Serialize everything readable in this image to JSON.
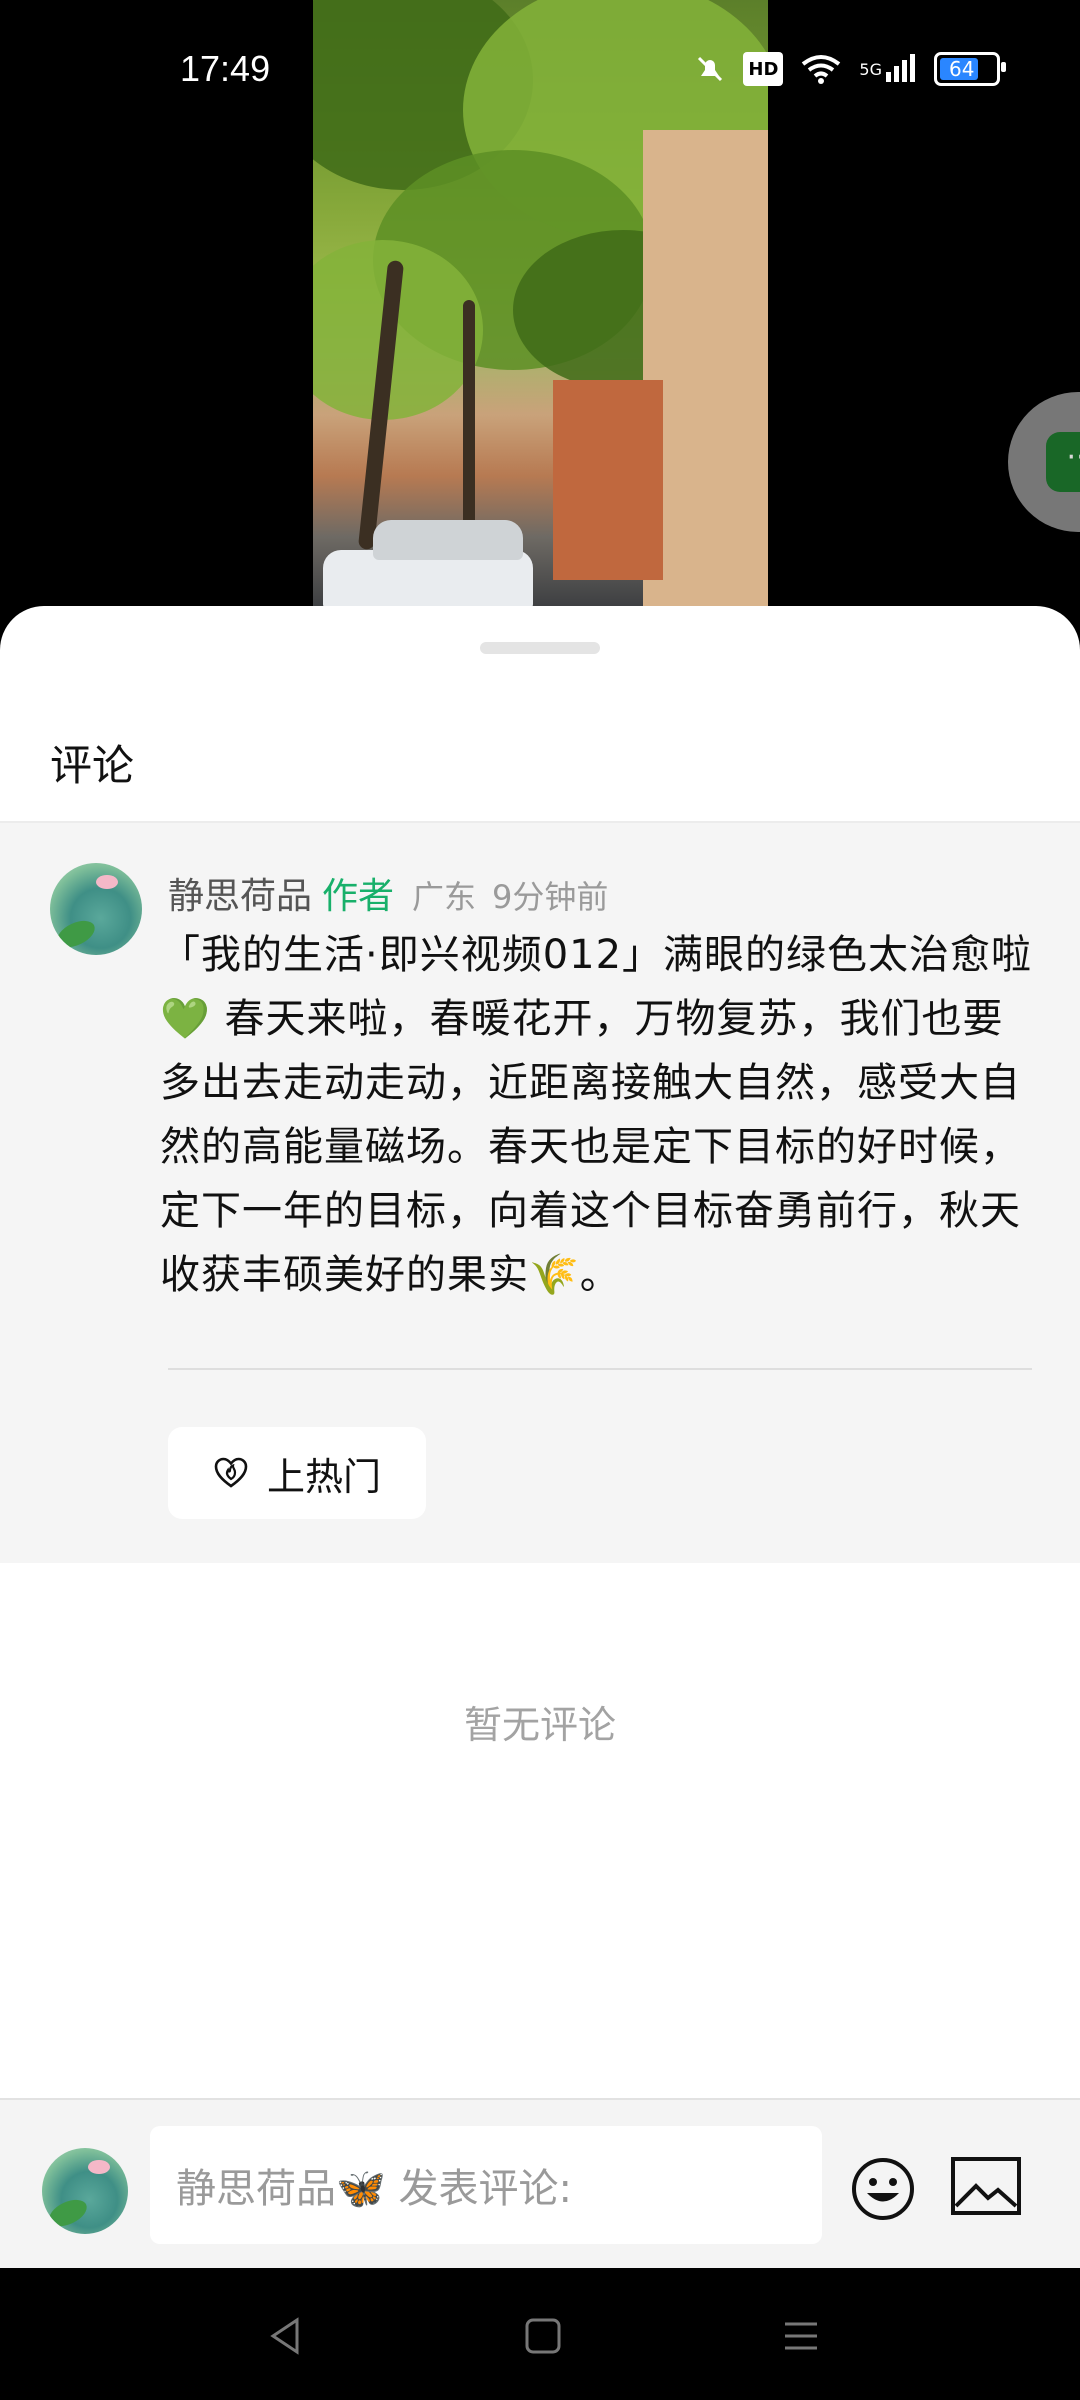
{
  "status_bar": {
    "time": "17:49",
    "network_label": "5G",
    "hd_label": "HD",
    "battery_level": "64"
  },
  "sheet": {
    "title": "评论"
  },
  "post": {
    "username": "静思荷品",
    "author_tag": "作者",
    "region": "广东",
    "time_ago": "9分钟前",
    "content": "「我的生活·即兴视频012」满眼的绿色太治愈啦💚 春天来啦，春暖花开，万物复苏，我们也要多出去走动走动，近距离接触大自然，感受大自然的高能量磁场。春天也是定下目标的好时候，定下一年的目标，向着这个目标奋勇前行，秋天收获丰硕美好的果实🌾。",
    "hot_button_label": "上热门"
  },
  "comments": {
    "empty_text": "暂无评论"
  },
  "input_bar": {
    "placeholder": "静思荷品🦋 发表评论:"
  },
  "colors": {
    "author_tag": "#18b06a",
    "post_bg": "#f5f5f5",
    "muted_text": "#9a9a9a"
  },
  "icons": {
    "hot": "heart-flame-icon",
    "emoji": "smiley-icon",
    "image": "image-icon",
    "nav_back": "back-triangle-icon",
    "nav_home": "home-square-icon",
    "nav_menu": "menu-lines-icon"
  }
}
